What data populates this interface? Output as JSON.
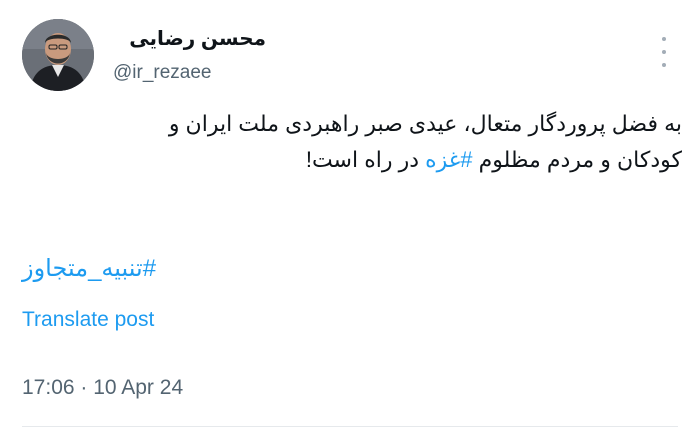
{
  "author": {
    "display_name": "محسن رضایی",
    "handle": "@ir_rezaee"
  },
  "tweet": {
    "line1": "به فضل پروردگار متعال، عیدی صبر راهبردی ملت ایران و",
    "line2_start": "کودکان و مردم مظلوم ",
    "line2_hashtag": "#غزه",
    "line2_end": " در راه است!",
    "hashtag": "#تنبیه_متجاوز"
  },
  "translate_label": "Translate post",
  "timestamp": "17:06 · 10 Apr 24",
  "icons": {
    "more": "more-options-icon",
    "avatar": "profile-avatar"
  },
  "colors": {
    "link": "#1d9bf0",
    "text": "#0f1419",
    "secondary": "#536471"
  }
}
